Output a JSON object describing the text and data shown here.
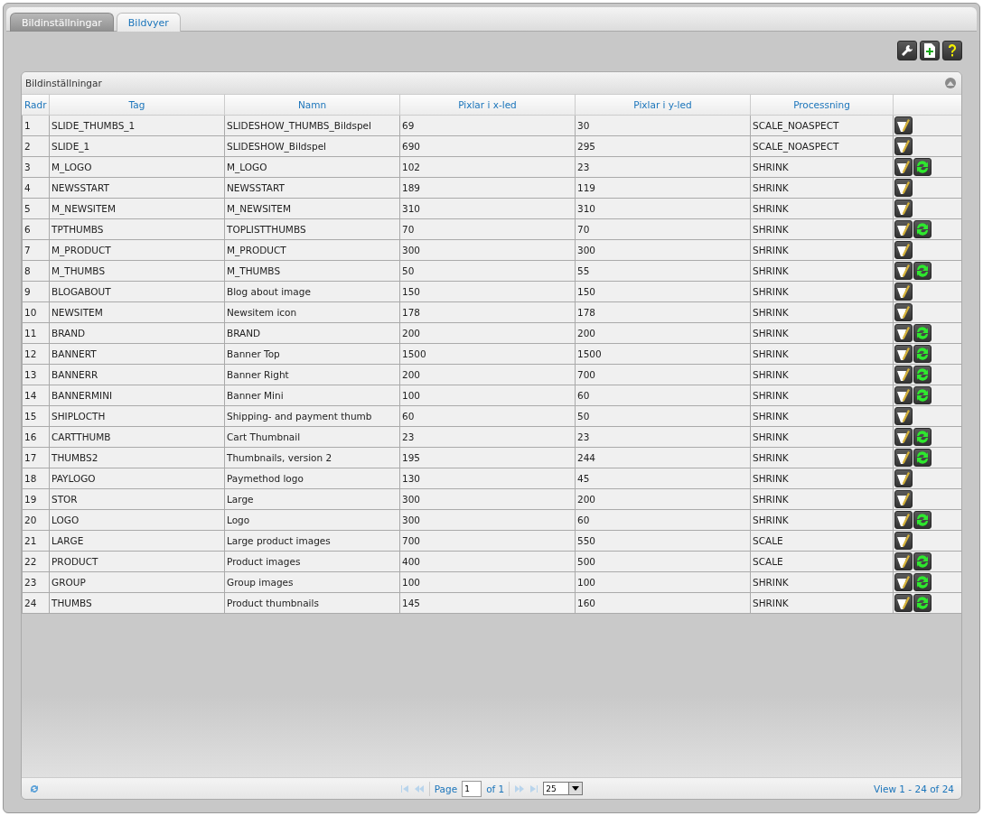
{
  "tabs": [
    {
      "label": "Bildinställningar",
      "selected": true
    },
    {
      "label": "Bildvyer",
      "selected": false
    }
  ],
  "toolbar": [
    {
      "kind": "settings"
    },
    {
      "kind": "add"
    },
    {
      "kind": "help"
    }
  ],
  "panel": {
    "title": "Bildinställningar",
    "columns": [
      "Radr",
      "Tag",
      "Namn",
      "Pixlar i x-led",
      "Pixlar i y-led",
      "Processning"
    ],
    "rows": [
      {
        "cells": [
          "1",
          "SLIDE_THUMBS_1",
          "SLIDESHOW_THUMBS_Bildspel",
          "69",
          "30",
          "SCALE_NOASPECT"
        ],
        "actions": [
          {
            "kind": "edit"
          }
        ]
      },
      {
        "cells": [
          "2",
          "SLIDE_1",
          "SLIDESHOW_Bildspel",
          "690",
          "295",
          "SCALE_NOASPECT"
        ],
        "actions": [
          {
            "kind": "edit"
          }
        ]
      },
      {
        "cells": [
          "3",
          "M_LOGO",
          "M_LOGO",
          "102",
          "23",
          "SHRINK"
        ],
        "actions": [
          {
            "kind": "edit"
          },
          {
            "kind": "refresh"
          }
        ]
      },
      {
        "cells": [
          "4",
          "NEWSSTART",
          "NEWSSTART",
          "189",
          "119",
          "SHRINK"
        ],
        "actions": [
          {
            "kind": "edit"
          }
        ]
      },
      {
        "cells": [
          "5",
          "M_NEWSITEM",
          "M_NEWSITEM",
          "310",
          "310",
          "SHRINK"
        ],
        "actions": [
          {
            "kind": "edit"
          }
        ]
      },
      {
        "cells": [
          "6",
          "TPTHUMBS",
          "TOPLISTTHUMBS",
          "70",
          "70",
          "SHRINK"
        ],
        "actions": [
          {
            "kind": "edit"
          },
          {
            "kind": "refresh"
          }
        ]
      },
      {
        "cells": [
          "7",
          "M_PRODUCT",
          "M_PRODUCT",
          "300",
          "300",
          "SHRINK"
        ],
        "actions": [
          {
            "kind": "edit"
          }
        ]
      },
      {
        "cells": [
          "8",
          "M_THUMBS",
          "M_THUMBS",
          "50",
          "55",
          "SHRINK"
        ],
        "actions": [
          {
            "kind": "edit"
          },
          {
            "kind": "refresh"
          }
        ]
      },
      {
        "cells": [
          "9",
          "BLOGABOUT",
          "Blog about image",
          "150",
          "150",
          "SHRINK"
        ],
        "actions": [
          {
            "kind": "edit"
          }
        ]
      },
      {
        "cells": [
          "10",
          "NEWSITEM",
          "Newsitem icon",
          "178",
          "178",
          "SHRINK"
        ],
        "actions": [
          {
            "kind": "edit"
          }
        ]
      },
      {
        "cells": [
          "11",
          "BRAND",
          "BRAND",
          "200",
          "200",
          "SHRINK"
        ],
        "actions": [
          {
            "kind": "edit"
          },
          {
            "kind": "refresh"
          }
        ]
      },
      {
        "cells": [
          "12",
          "BANNERT",
          "Banner Top",
          "1500",
          "1500",
          "SHRINK"
        ],
        "actions": [
          {
            "kind": "edit"
          },
          {
            "kind": "refresh"
          }
        ]
      },
      {
        "cells": [
          "13",
          "BANNERR",
          "Banner Right",
          "200",
          "700",
          "SHRINK"
        ],
        "actions": [
          {
            "kind": "edit"
          },
          {
            "kind": "refresh"
          }
        ]
      },
      {
        "cells": [
          "14",
          "BANNERMINI",
          "Banner Mini",
          "100",
          "60",
          "SHRINK"
        ],
        "actions": [
          {
            "kind": "edit"
          },
          {
            "kind": "refresh"
          }
        ]
      },
      {
        "cells": [
          "15",
          "SHIPLOCTH",
          "Shipping- and payment thumb",
          "60",
          "50",
          "SHRINK"
        ],
        "actions": [
          {
            "kind": "edit"
          }
        ]
      },
      {
        "cells": [
          "16",
          "CARTTHUMB",
          "Cart Thumbnail",
          "23",
          "23",
          "SHRINK"
        ],
        "actions": [
          {
            "kind": "edit"
          },
          {
            "kind": "refresh"
          }
        ]
      },
      {
        "cells": [
          "17",
          "THUMBS2",
          "Thumbnails, version 2",
          "195",
          "244",
          "SHRINK"
        ],
        "actions": [
          {
            "kind": "edit"
          },
          {
            "kind": "refresh"
          }
        ]
      },
      {
        "cells": [
          "18",
          "PAYLOGO",
          "Paymethod logo",
          "130",
          "45",
          "SHRINK"
        ],
        "actions": [
          {
            "kind": "edit"
          }
        ]
      },
      {
        "cells": [
          "19",
          "STOR",
          "Large",
          "300",
          "200",
          "SHRINK"
        ],
        "actions": [
          {
            "kind": "edit"
          }
        ]
      },
      {
        "cells": [
          "20",
          "LOGO",
          "Logo",
          "300",
          "60",
          "SHRINK"
        ],
        "actions": [
          {
            "kind": "edit"
          },
          {
            "kind": "refresh"
          }
        ]
      },
      {
        "cells": [
          "21",
          "LARGE",
          "Large product images",
          "700",
          "550",
          "SCALE"
        ],
        "actions": [
          {
            "kind": "edit"
          }
        ]
      },
      {
        "cells": [
          "22",
          "PRODUCT",
          "Product images",
          "400",
          "500",
          "SCALE"
        ],
        "actions": [
          {
            "kind": "edit"
          },
          {
            "kind": "refresh"
          }
        ]
      },
      {
        "cells": [
          "23",
          "GROUP",
          "Group images",
          "100",
          "100",
          "SHRINK"
        ],
        "actions": [
          {
            "kind": "edit"
          },
          {
            "kind": "refresh"
          }
        ]
      },
      {
        "cells": [
          "24",
          "THUMBS",
          "Product thumbnails",
          "145",
          "160",
          "SHRINK"
        ],
        "actions": [
          {
            "kind": "edit"
          },
          {
            "kind": "refresh"
          }
        ]
      }
    ],
    "pager": {
      "page_label": "Page",
      "page": "1",
      "of": "of 1",
      "page_size": "25",
      "info": "View 1 - 24 of 24"
    }
  }
}
